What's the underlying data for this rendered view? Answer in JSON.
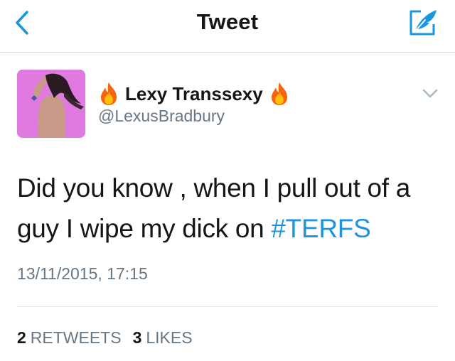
{
  "nav": {
    "title": "Tweet"
  },
  "icons": {
    "back": "chevron-left-icon",
    "compose": "feather-compose-icon",
    "flame": "fire-emoji-icon",
    "caret": "chevron-down-icon"
  },
  "colors": {
    "accent": "#1b95e0",
    "text": "#14171a",
    "secondary": "#657786",
    "avatar_bg": "#e07ae0"
  },
  "tweet": {
    "display_name": "Lexy Transsexy",
    "handle": "@LexusBradbury",
    "text": "Did you know , when I pull out of a guy I wipe my dick on ",
    "hashtag": "#TERFS",
    "timestamp": "13/11/2015, 17:15",
    "retweets_count": "2",
    "retweets_label": "RETWEETS",
    "likes_count": "3",
    "likes_label": "LIKES"
  }
}
